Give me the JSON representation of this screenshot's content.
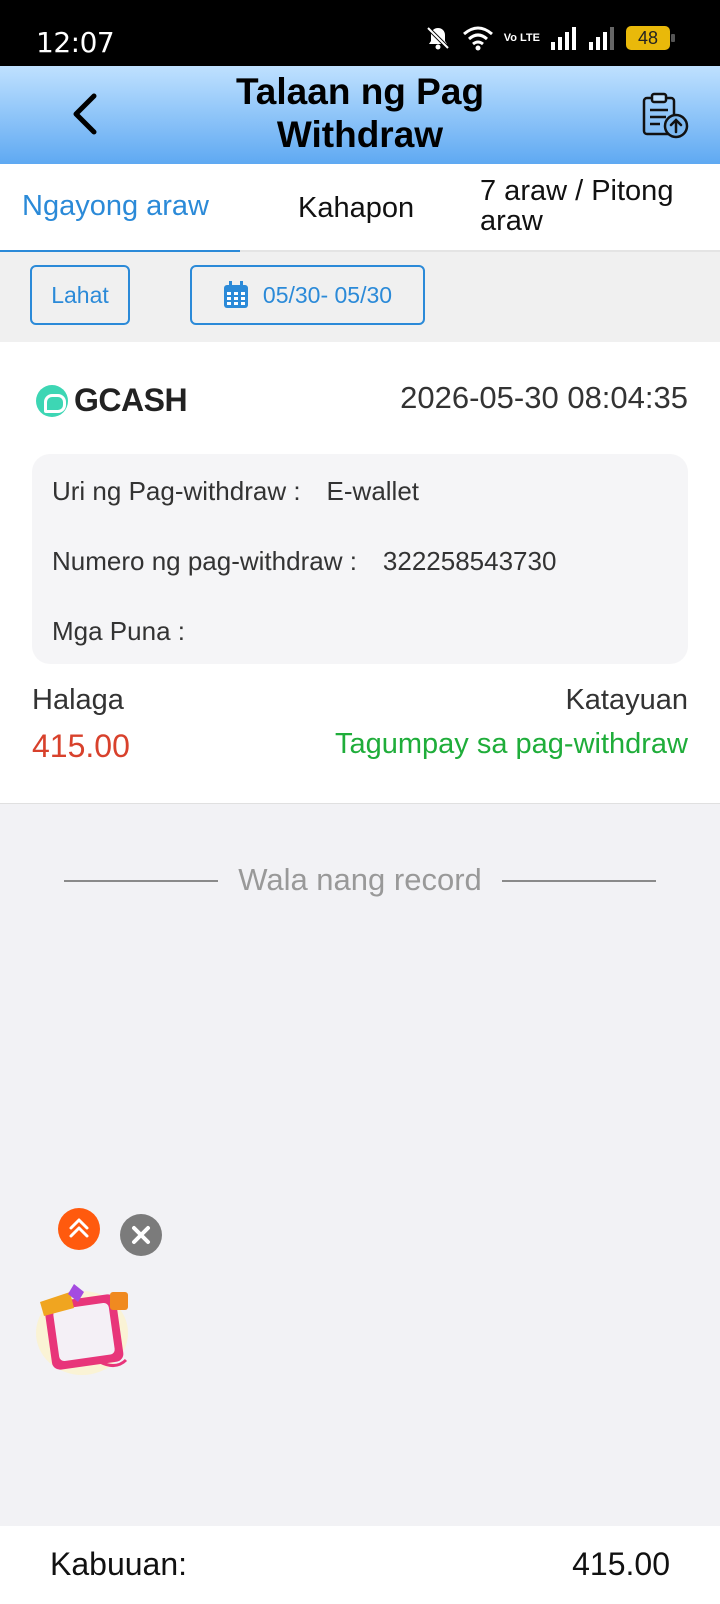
{
  "status_bar": {
    "time": "12:07",
    "network_label": "Vo LTE",
    "battery": "48"
  },
  "header": {
    "title": "Talaan ng Pag Withdraw"
  },
  "tabs": [
    {
      "label": "Ngayong araw",
      "active": true
    },
    {
      "label": "Kahapon",
      "active": false
    },
    {
      "label": "7 araw / Pitong araw",
      "active": false
    }
  ],
  "filters": {
    "all_label": "Lahat",
    "date_range": "05/30- 05/30"
  },
  "record": {
    "method": "GCASH",
    "datetime": "2026-05-30 08:04:35",
    "type_label": "Uri ng Pag-withdraw :",
    "type_value": "E-wallet",
    "number_label": "Numero ng pag-withdraw :",
    "number_value": "322258543730",
    "remarks_label": "Mga Puna :",
    "remarks_value": "",
    "amount_label": "Halaga",
    "amount_value": "415.00",
    "status_label": "Katayuan",
    "status_value": "Tagumpay sa pag-withdraw"
  },
  "no_more": "Wala nang record",
  "footer": {
    "total_label": "Kabuuan:",
    "total_value": "415.00"
  },
  "colors": {
    "accent": "#2b8ad8",
    "amount": "#d8412c",
    "success": "#1fad3a",
    "header_top": "#bfe1ff",
    "header_bottom": "#5fa9f2"
  }
}
